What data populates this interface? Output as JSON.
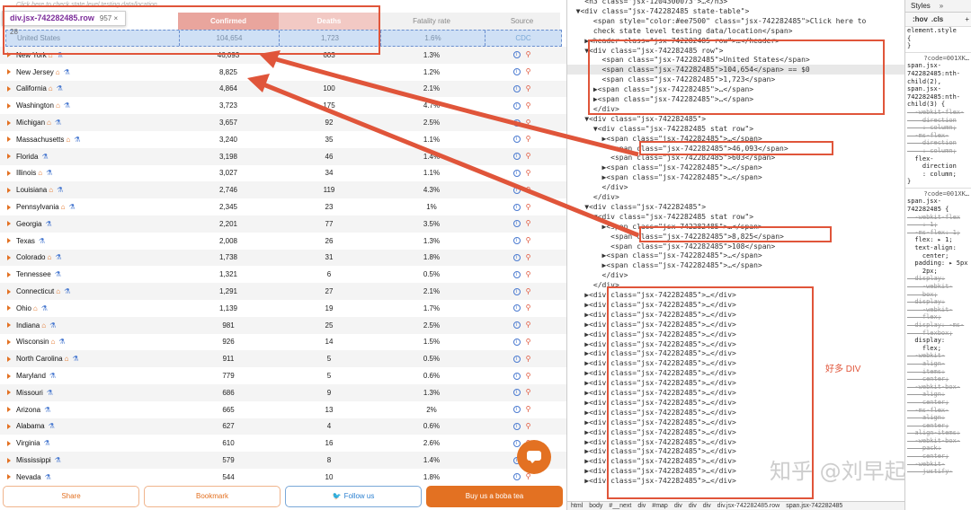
{
  "table": {
    "hint": "Click here to check state level testing data/location",
    "headers": {
      "name": "",
      "confirmed": "Confirmed",
      "deaths": "Deaths",
      "fatality": "Fatality rate",
      "source": "Source"
    },
    "us_row": {
      "name": "United States",
      "confirmed": "104,654",
      "deaths": "1,723",
      "fatality": "1.6%",
      "source": "CDC"
    },
    "rows": [
      {
        "name": "New York",
        "home": true,
        "flask": true,
        "confirmed": "46,093",
        "deaths": "603",
        "fatality": "1.3%"
      },
      {
        "name": "New Jersey",
        "home": true,
        "flask": true,
        "confirmed": "8,825",
        "deaths": "",
        "fatality": "1.2%"
      },
      {
        "name": "California",
        "home": true,
        "flask": true,
        "confirmed": "4,864",
        "deaths": "100",
        "fatality": "2.1%"
      },
      {
        "name": "Washington",
        "home": true,
        "flask": true,
        "confirmed": "3,723",
        "deaths": "175",
        "fatality": "4.7%"
      },
      {
        "name": "Michigan",
        "home": true,
        "flask": true,
        "confirmed": "3,657",
        "deaths": "92",
        "fatality": "2.5%"
      },
      {
        "name": "Massachusetts",
        "home": true,
        "flask": true,
        "confirmed": "3,240",
        "deaths": "35",
        "fatality": "1.1%"
      },
      {
        "name": "Florida",
        "home": false,
        "flask": true,
        "confirmed": "3,198",
        "deaths": "46",
        "fatality": "1.4%"
      },
      {
        "name": "Illinois",
        "home": true,
        "flask": true,
        "confirmed": "3,027",
        "deaths": "34",
        "fatality": "1.1%"
      },
      {
        "name": "Louisiana",
        "home": true,
        "flask": true,
        "confirmed": "2,746",
        "deaths": "119",
        "fatality": "4.3%"
      },
      {
        "name": "Pennsylvania",
        "home": true,
        "flask": true,
        "confirmed": "2,345",
        "deaths": "23",
        "fatality": "1%"
      },
      {
        "name": "Georgia",
        "home": false,
        "flask": true,
        "confirmed": "2,201",
        "deaths": "77",
        "fatality": "3.5%"
      },
      {
        "name": "Texas",
        "home": false,
        "flask": true,
        "confirmed": "2,008",
        "deaths": "26",
        "fatality": "1.3%"
      },
      {
        "name": "Colorado",
        "home": true,
        "flask": true,
        "confirmed": "1,738",
        "deaths": "31",
        "fatality": "1.8%"
      },
      {
        "name": "Tennessee",
        "home": false,
        "flask": true,
        "confirmed": "1,321",
        "deaths": "6",
        "fatality": "0.5%"
      },
      {
        "name": "Connecticut",
        "home": true,
        "flask": true,
        "confirmed": "1,291",
        "deaths": "27",
        "fatality": "2.1%"
      },
      {
        "name": "Ohio",
        "home": true,
        "flask": true,
        "confirmed": "1,139",
        "deaths": "19",
        "fatality": "1.7%"
      },
      {
        "name": "Indiana",
        "home": true,
        "flask": true,
        "confirmed": "981",
        "deaths": "25",
        "fatality": "2.5%"
      },
      {
        "name": "Wisconsin",
        "home": true,
        "flask": true,
        "confirmed": "926",
        "deaths": "14",
        "fatality": "1.5%"
      },
      {
        "name": "North Carolina",
        "home": true,
        "flask": true,
        "confirmed": "911",
        "deaths": "5",
        "fatality": "0.5%"
      },
      {
        "name": "Maryland",
        "home": false,
        "flask": true,
        "confirmed": "779",
        "deaths": "5",
        "fatality": "0.6%"
      },
      {
        "name": "Missouri",
        "home": false,
        "flask": true,
        "confirmed": "686",
        "deaths": "9",
        "fatality": "1.3%"
      },
      {
        "name": "Arizona",
        "home": false,
        "flask": true,
        "confirmed": "665",
        "deaths": "13",
        "fatality": "2%"
      },
      {
        "name": "Alabama",
        "home": false,
        "flask": true,
        "confirmed": "627",
        "deaths": "4",
        "fatality": "0.6%"
      },
      {
        "name": "Virginia",
        "home": false,
        "flask": true,
        "confirmed": "610",
        "deaths": "16",
        "fatality": "2.6%"
      },
      {
        "name": "Mississippi",
        "home": false,
        "flask": true,
        "confirmed": "579",
        "deaths": "8",
        "fatality": "1.4%"
      },
      {
        "name": "Nevada",
        "home": false,
        "flask": true,
        "confirmed": "544",
        "deaths": "10",
        "fatality": "1.8%"
      }
    ]
  },
  "tooltip": {
    "selector": "div.jsx-742282485.row",
    "dims": "957 × 28"
  },
  "buttons": {
    "share": "Share",
    "bookmark": "Bookmark",
    "follow": "Follow us",
    "boba": "Buy us a boba tea"
  },
  "devtools": {
    "dom_lines": [
      "    <h3 class=\"jsx-1204300073\">…</h3>",
      "  ▼<div class=\"jsx-742282485 state-table\">",
      "      <span style=\"color:#ee7500\" class=\"jsx-742282485\">Click here to",
      "      check state level testing data/location</span>",
      "    ▶<header class=\"jsx-742282485 row\">…</header>",
      "    ▼<div class=\"jsx-742282485 row\">",
      "        <span class=\"jsx-742282485\">United States</span>",
      "        <span class=\"jsx-742282485\">104,654</span> == $0",
      "        <span class=\"jsx-742282485\">1,723</span>",
      "      ▶<span class=\"jsx-742282485\">…</span>",
      "      ▶<span class=\"jsx-742282485\">…</span>",
      "      </div>",
      "    ▼<div class=\"jsx-742282485\">",
      "      ▼<div class=\"jsx-742282485 stat row\">",
      "        ▶<span class=\"jsx-742282485\">…</span>",
      "          <span class=\"jsx-742282485\">46,093</span>",
      "          <span class=\"jsx-742282485\">603</span>",
      "        ▶<span class=\"jsx-742282485\">…</span>",
      "        ▶<span class=\"jsx-742282485\">…</span>",
      "        </div>",
      "      </div>",
      "    ▼<div class=\"jsx-742282485\">",
      "      ▼<div class=\"jsx-742282485 stat row\">",
      "        ▶<span class=\"jsx-742282485\">…</span>",
      "          <span class=\"jsx-742282485\">8,825</span>",
      "          <span class=\"jsx-742282485\">108</span>",
      "        ▶<span class=\"jsx-742282485\">…</span>",
      "        ▶<span class=\"jsx-742282485\">…</span>",
      "        </div>",
      "      </div>",
      "    ▶<div class=\"jsx-742282485\">…</div>",
      "    ▶<div class=\"jsx-742282485\">…</div>",
      "    ▶<div class=\"jsx-742282485\">…</div>",
      "    ▶<div class=\"jsx-742282485\">…</div>",
      "    ▶<div class=\"jsx-742282485\">…</div>",
      "    ▶<div class=\"jsx-742282485\">…</div>",
      "    ▶<div class=\"jsx-742282485\">…</div>",
      "    ▶<div class=\"jsx-742282485\">…</div>",
      "    ▶<div class=\"jsx-742282485\">…</div>",
      "    ▶<div class=\"jsx-742282485\">…</div>",
      "    ▶<div class=\"jsx-742282485\">…</div>",
      "    ▶<div class=\"jsx-742282485\">…</div>",
      "    ▶<div class=\"jsx-742282485\">…</div>",
      "    ▶<div class=\"jsx-742282485\">…</div>",
      "    ▶<div class=\"jsx-742282485\">…</div>",
      "    ▶<div class=\"jsx-742282485\">…</div>",
      "    ▶<div class=\"jsx-742282485\">…</div>",
      "    ▶<div class=\"jsx-742282485\">…</div>",
      "    ▶<div class=\"jsx-742282485\">…</div>",
      "    ▶<div class=\"jsx-742282485\">…</div>"
    ],
    "note": "好多 DIV",
    "watermark": "知乎 @刘早起",
    "breadcrumbs": [
      "html",
      "body",
      "#__next",
      "div",
      "#map",
      "div",
      "div",
      "div",
      "div.jsx-742282485.row",
      "span.jsx-742282485"
    ],
    "styles_tabs": [
      "Styles",
      "»"
    ],
    "filter": {
      "hov": ":hov",
      "cls": ".cls",
      "plus": "+"
    },
    "styles_lines": [
      "element.style",
      "{",
      "}",
      "?code=001XK…",
      "span.jsx-",
      "742282485:nth-",
      "child(2),",
      "span.jsx-",
      "742282485:nth-",
      "child(3) {",
      "  -webkit-flex-",
      "    direction",
      "    : column;",
      "  -ms-flex-",
      "    direction",
      "    : column;",
      "  flex-",
      "    direction",
      "    : column;",
      "}",
      "?code=001XK…",
      "span.jsx-",
      "742282485 {",
      "  -webkit-flex",
      "    : 1;",
      "  -ms-flex: 1;",
      "  flex: ▸ 1;",
      "  text-align:",
      "    center;",
      "  padding: ▸ 5px",
      "    2px;",
      "  display:",
      "    -webkit-",
      "    box;",
      "  display:",
      "    -webkit-",
      "    flex;",
      "  display: -ms-",
      "    flexbox;",
      "  display:",
      "    flex;",
      "  -webkit-",
      "    align-",
      "    items:",
      "    center;",
      "  -webkit-box-",
      "    align:",
      "    center;",
      "  -ms-flex-",
      "    align:",
      "    center;",
      "  align-items:",
      "  -webkit-box-",
      "    pack:",
      "    center;",
      "  -webkit-",
      "    justify-"
    ]
  },
  "colors": {
    "accent": "#e37122",
    "annotation": "#e0553a",
    "highlight": "#cfe0f5"
  }
}
